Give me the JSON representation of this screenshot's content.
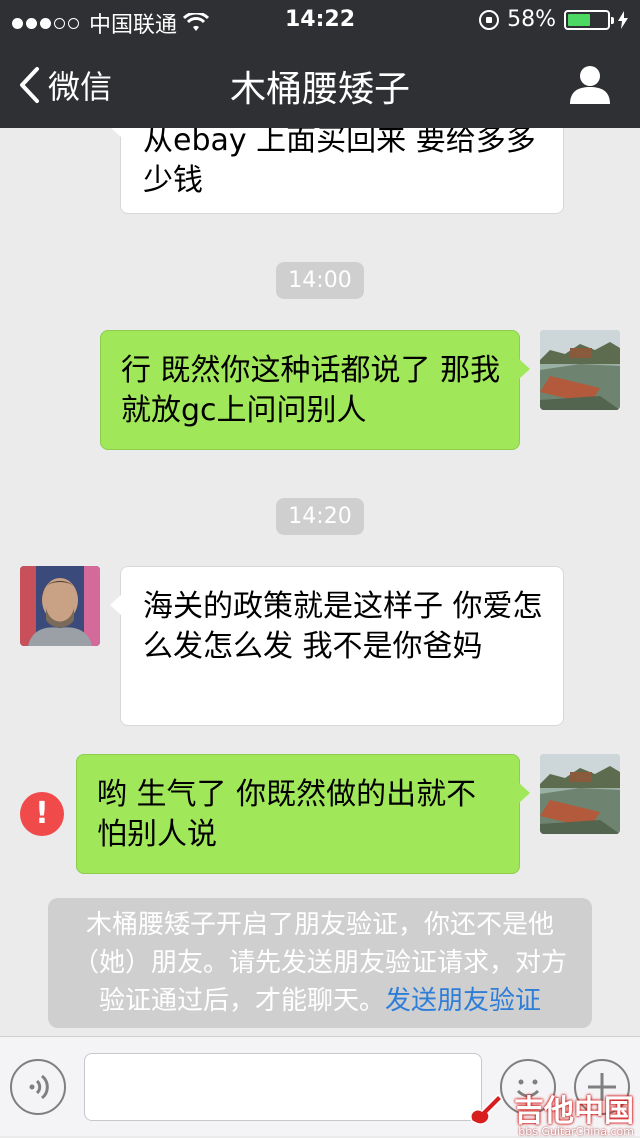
{
  "status_bar": {
    "carrier": "中国联通",
    "time": "14:22",
    "battery_percent": "58%",
    "battery_level": 0.58
  },
  "nav": {
    "back_label": "微信",
    "title": "木桶腰矮子"
  },
  "messages": [
    {
      "direction": "in",
      "text": "从ebay 上面买回来 要给多多少钱"
    },
    {
      "timestamp": "14:00"
    },
    {
      "direction": "out",
      "text": " 行 既然你这种话都说了 那我就放gc上问问别人"
    },
    {
      "timestamp": "14:20"
    },
    {
      "direction": "in",
      "text": "海关的政策就是这样子 你爱怎么发怎么发 我不是你爸妈"
    },
    {
      "direction": "out",
      "text": "哟 生气了 你既然做的出就不怕别人说",
      "failed": true
    }
  ],
  "error_icon_glyph": "!",
  "system_notice": {
    "text": "木桶腰矮子开启了朋友验证，你还不是他（她）朋友。请先发送朋友验证请求，对方验证通过后，才能聊天。",
    "link_text": "发送朋友验证"
  },
  "input_bar": {
    "placeholder": ""
  },
  "watermark": {
    "title": "吉他中国",
    "url": "bbs.GuitarChina.com"
  },
  "colors": {
    "nav_background": "#2f3034",
    "outgoing_bubble": "#a0e75a",
    "incoming_bubble": "#ffffff",
    "error": "#f04a4a",
    "link": "#2e7ed8"
  },
  "icons": [
    "wifi-icon",
    "lock-rotation-icon",
    "battery-icon",
    "back-chevron-icon",
    "profile-icon",
    "error-icon",
    "voice-icon",
    "emoji-icon",
    "plus-icon"
  ]
}
